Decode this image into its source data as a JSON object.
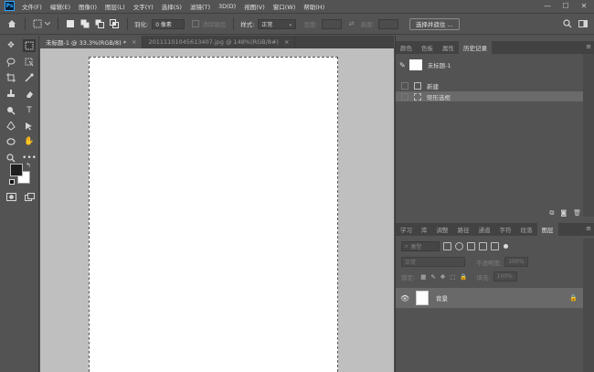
{
  "app": {
    "logo": "Ps"
  },
  "menu": [
    "文件(F)",
    "编辑(E)",
    "图像(I)",
    "图层(L)",
    "文字(Y)",
    "选择(S)",
    "滤镜(T)",
    "3D(D)",
    "视图(V)",
    "窗口(W)",
    "帮助(H)"
  ],
  "window_controls": {
    "minimize": "—",
    "maximize": "☐",
    "close": "✕"
  },
  "options": {
    "feather_label": "羽化:",
    "feather_value": "0 像素",
    "antialias_label": "消除锯齿",
    "style_label": "样式:",
    "style_value": "正常",
    "width_label": "宽度:",
    "height_label": "高度:",
    "select_mask_button": "选择并遮住 ..."
  },
  "doc_tabs": [
    {
      "label": "未标题-1 @ 33.3%(RGB/8) *",
      "close": "×"
    },
    {
      "label": "20111101045613407.jpg @ 148%(RGB/8#)",
      "close": "×"
    }
  ],
  "history_panel": {
    "tabs": [
      "颜色",
      "色板",
      "属性",
      "历史记录"
    ],
    "snapshot_label": "未标题-1",
    "items": [
      "新建",
      "矩形选框"
    ]
  },
  "layers_panel": {
    "tabs": [
      "学习",
      "库",
      "调整",
      "路径",
      "通道",
      "字符",
      "段落",
      "图层"
    ],
    "filter_placeholder": "类型",
    "blend_mode": "正常",
    "opacity_label": "不透明度:",
    "opacity_value": "100%",
    "lock_label": "锁定:",
    "fill_label": "填充:",
    "fill_value": "100%",
    "layers": [
      {
        "name": "背景"
      }
    ]
  },
  "colors": {
    "foreground": "#1f1f1f",
    "background": "#ffffff"
  }
}
